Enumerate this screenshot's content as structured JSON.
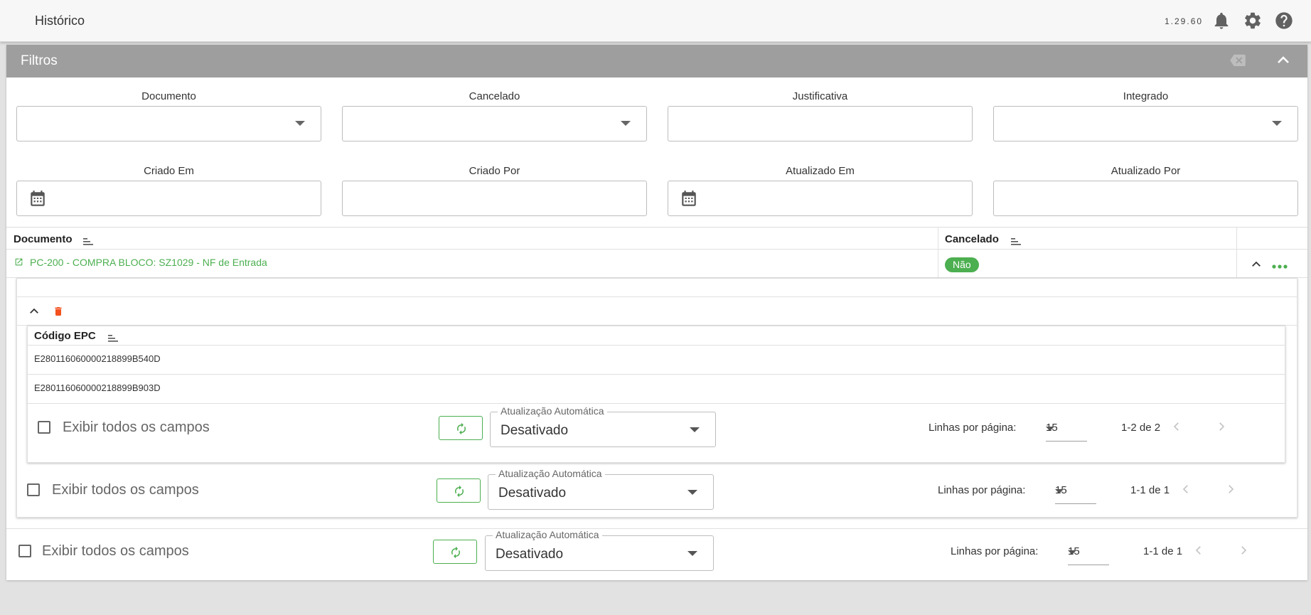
{
  "header": {
    "title": "Histórico",
    "version": "1.29.60",
    "icons": [
      "bell-icon",
      "gear-icon",
      "help-icon"
    ]
  },
  "filters": {
    "title": "Filtros",
    "fields": [
      {
        "label": "Documento",
        "type": "select",
        "value": ""
      },
      {
        "label": "Cancelado",
        "type": "select",
        "value": ""
      },
      {
        "label": "Justificativa",
        "type": "text",
        "value": ""
      },
      {
        "label": "Integrado",
        "type": "select",
        "value": ""
      },
      {
        "label": "Criado Em",
        "type": "date",
        "value": ""
      },
      {
        "label": "Criado Por",
        "type": "text",
        "value": ""
      },
      {
        "label": "Atualizado Em",
        "type": "date",
        "value": ""
      },
      {
        "label": "Atualizado Por",
        "type": "text",
        "value": ""
      }
    ]
  },
  "table": {
    "columns": [
      "Documento",
      "Cancelado"
    ],
    "rows": [
      {
        "documento": "PC-200 - COMPRA BLOCO: SZ1029 - NF de Entrada",
        "cancelado": "Não",
        "expanded": true
      }
    ]
  },
  "detail": {
    "column": "Código EPC",
    "rows": [
      "E280116060000218899B540D",
      "E280116060000218899B903D"
    ]
  },
  "footers": [
    {
      "show_all": "Exibir todos os campos",
      "auto_label": "Atualização Automática",
      "auto_value": "Desativado",
      "rows_label": "Linhas por página:",
      "rows_value": "15",
      "range": "1-2 de 2"
    },
    {
      "show_all": "Exibir todos os campos",
      "auto_label": "Atualização Automática",
      "auto_value": "Desativado",
      "rows_label": "Linhas por página:",
      "rows_value": "15",
      "range": "1-1 de 1"
    },
    {
      "show_all": "Exibir todos os campos",
      "auto_label": "Atualização Automática",
      "auto_value": "Desativado",
      "rows_label": "Linhas por página:",
      "rows_value": "15",
      "range": "1-1 de 1"
    }
  ],
  "colors": {
    "accent": "#4caf50",
    "delete": "#f4511e",
    "filters_header": "#9e9e9e"
  }
}
